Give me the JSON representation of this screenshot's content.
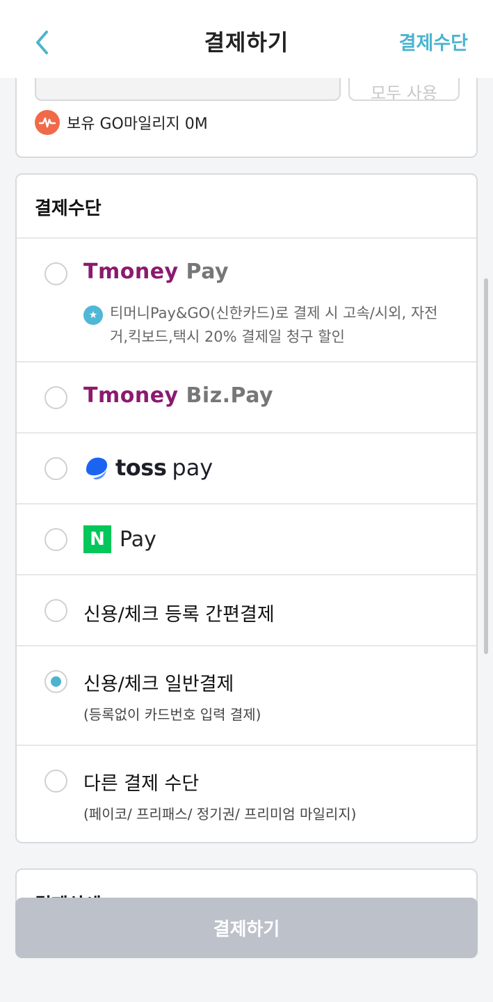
{
  "header": {
    "title": "결제하기",
    "right_link": "결제수단"
  },
  "mileage": {
    "button_label": "모두 사용",
    "balance_text": "보유 GO마일리지 0M"
  },
  "payment": {
    "section_title": "결제수단",
    "options": [
      {
        "brand_main": "Tmoney",
        "brand_sub": "Pay",
        "benefit": "티머니Pay&GO(신한카드)로 결제 시 고속/시외, 자전거,킥보드,택시 20% 결제일 청구 할인",
        "selected": false
      },
      {
        "brand_main": "Tmoney",
        "brand_sub": "Biz.Pay",
        "selected": false
      },
      {
        "brand_word": "toss",
        "brand_sub": "pay",
        "selected": false
      },
      {
        "brand_box": "N",
        "brand_sub": "Pay",
        "selected": false
      },
      {
        "label": "신용/체크 등록 간편결제",
        "selected": false
      },
      {
        "label": "신용/체크 일반결제",
        "sub": "(등록없이 카드번호 입력 결제)",
        "selected": true
      },
      {
        "label": "다른 결제 수단",
        "sub": "(페이코/ 프리패스/ 정기권/ 프리미엄 마일리지)",
        "selected": false
      }
    ]
  },
  "detail": {
    "title": "결제상세"
  },
  "footer": {
    "pay_button": "결제하기"
  },
  "colors": {
    "accent": "#4bb4cf",
    "tmoney_purple": "#8b1a6e",
    "naver_green": "#03c75a",
    "mileage_orange": "#f06a4a",
    "disabled_button": "#bcc1ca"
  },
  "icons": [
    "back-chevron-icon",
    "mileage-icon",
    "benefit-star-icon",
    "toss-logo-icon",
    "naver-n-icon"
  ]
}
